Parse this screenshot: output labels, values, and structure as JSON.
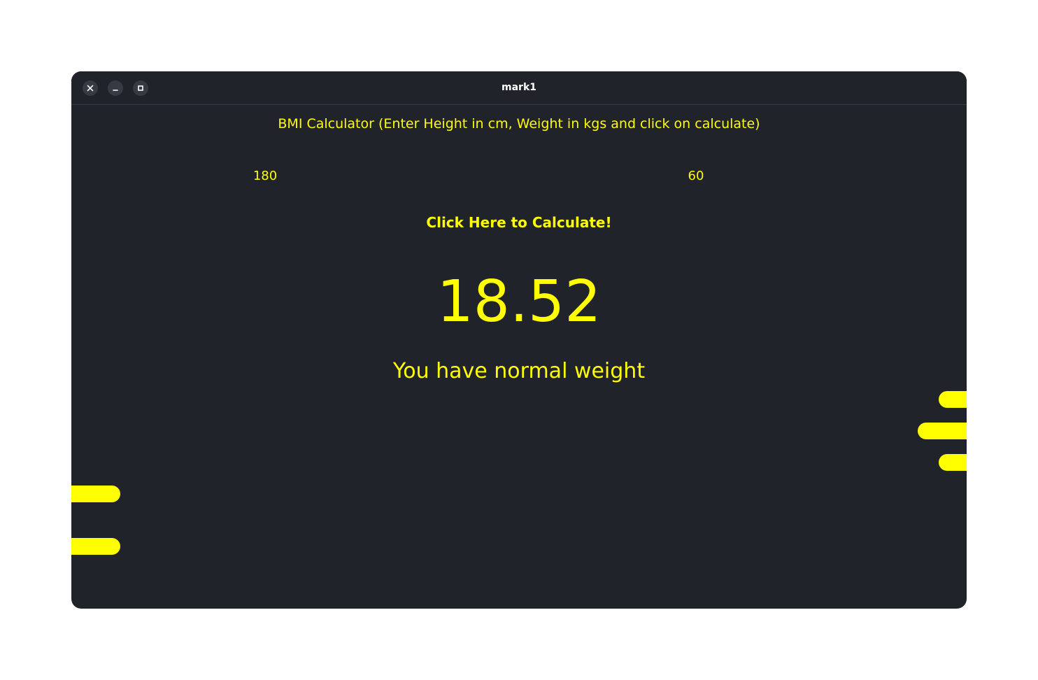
{
  "window": {
    "title": "mark1"
  },
  "app": {
    "header": "BMI Calculator (Enter Height in cm, Weight in kgs and click on calculate)",
    "height_value": "180",
    "weight_value": "60",
    "calculate_label": "Click Here to Calculate!",
    "bmi_value": "18.52",
    "bmi_status": "You have normal weight"
  },
  "colors": {
    "background": "#20232a",
    "accent": "#ffff00",
    "titlebar_text": "#ffffff"
  },
  "icons": {
    "close": "close-icon",
    "minimize": "minimize-icon",
    "maximize": "maximize-icon"
  }
}
